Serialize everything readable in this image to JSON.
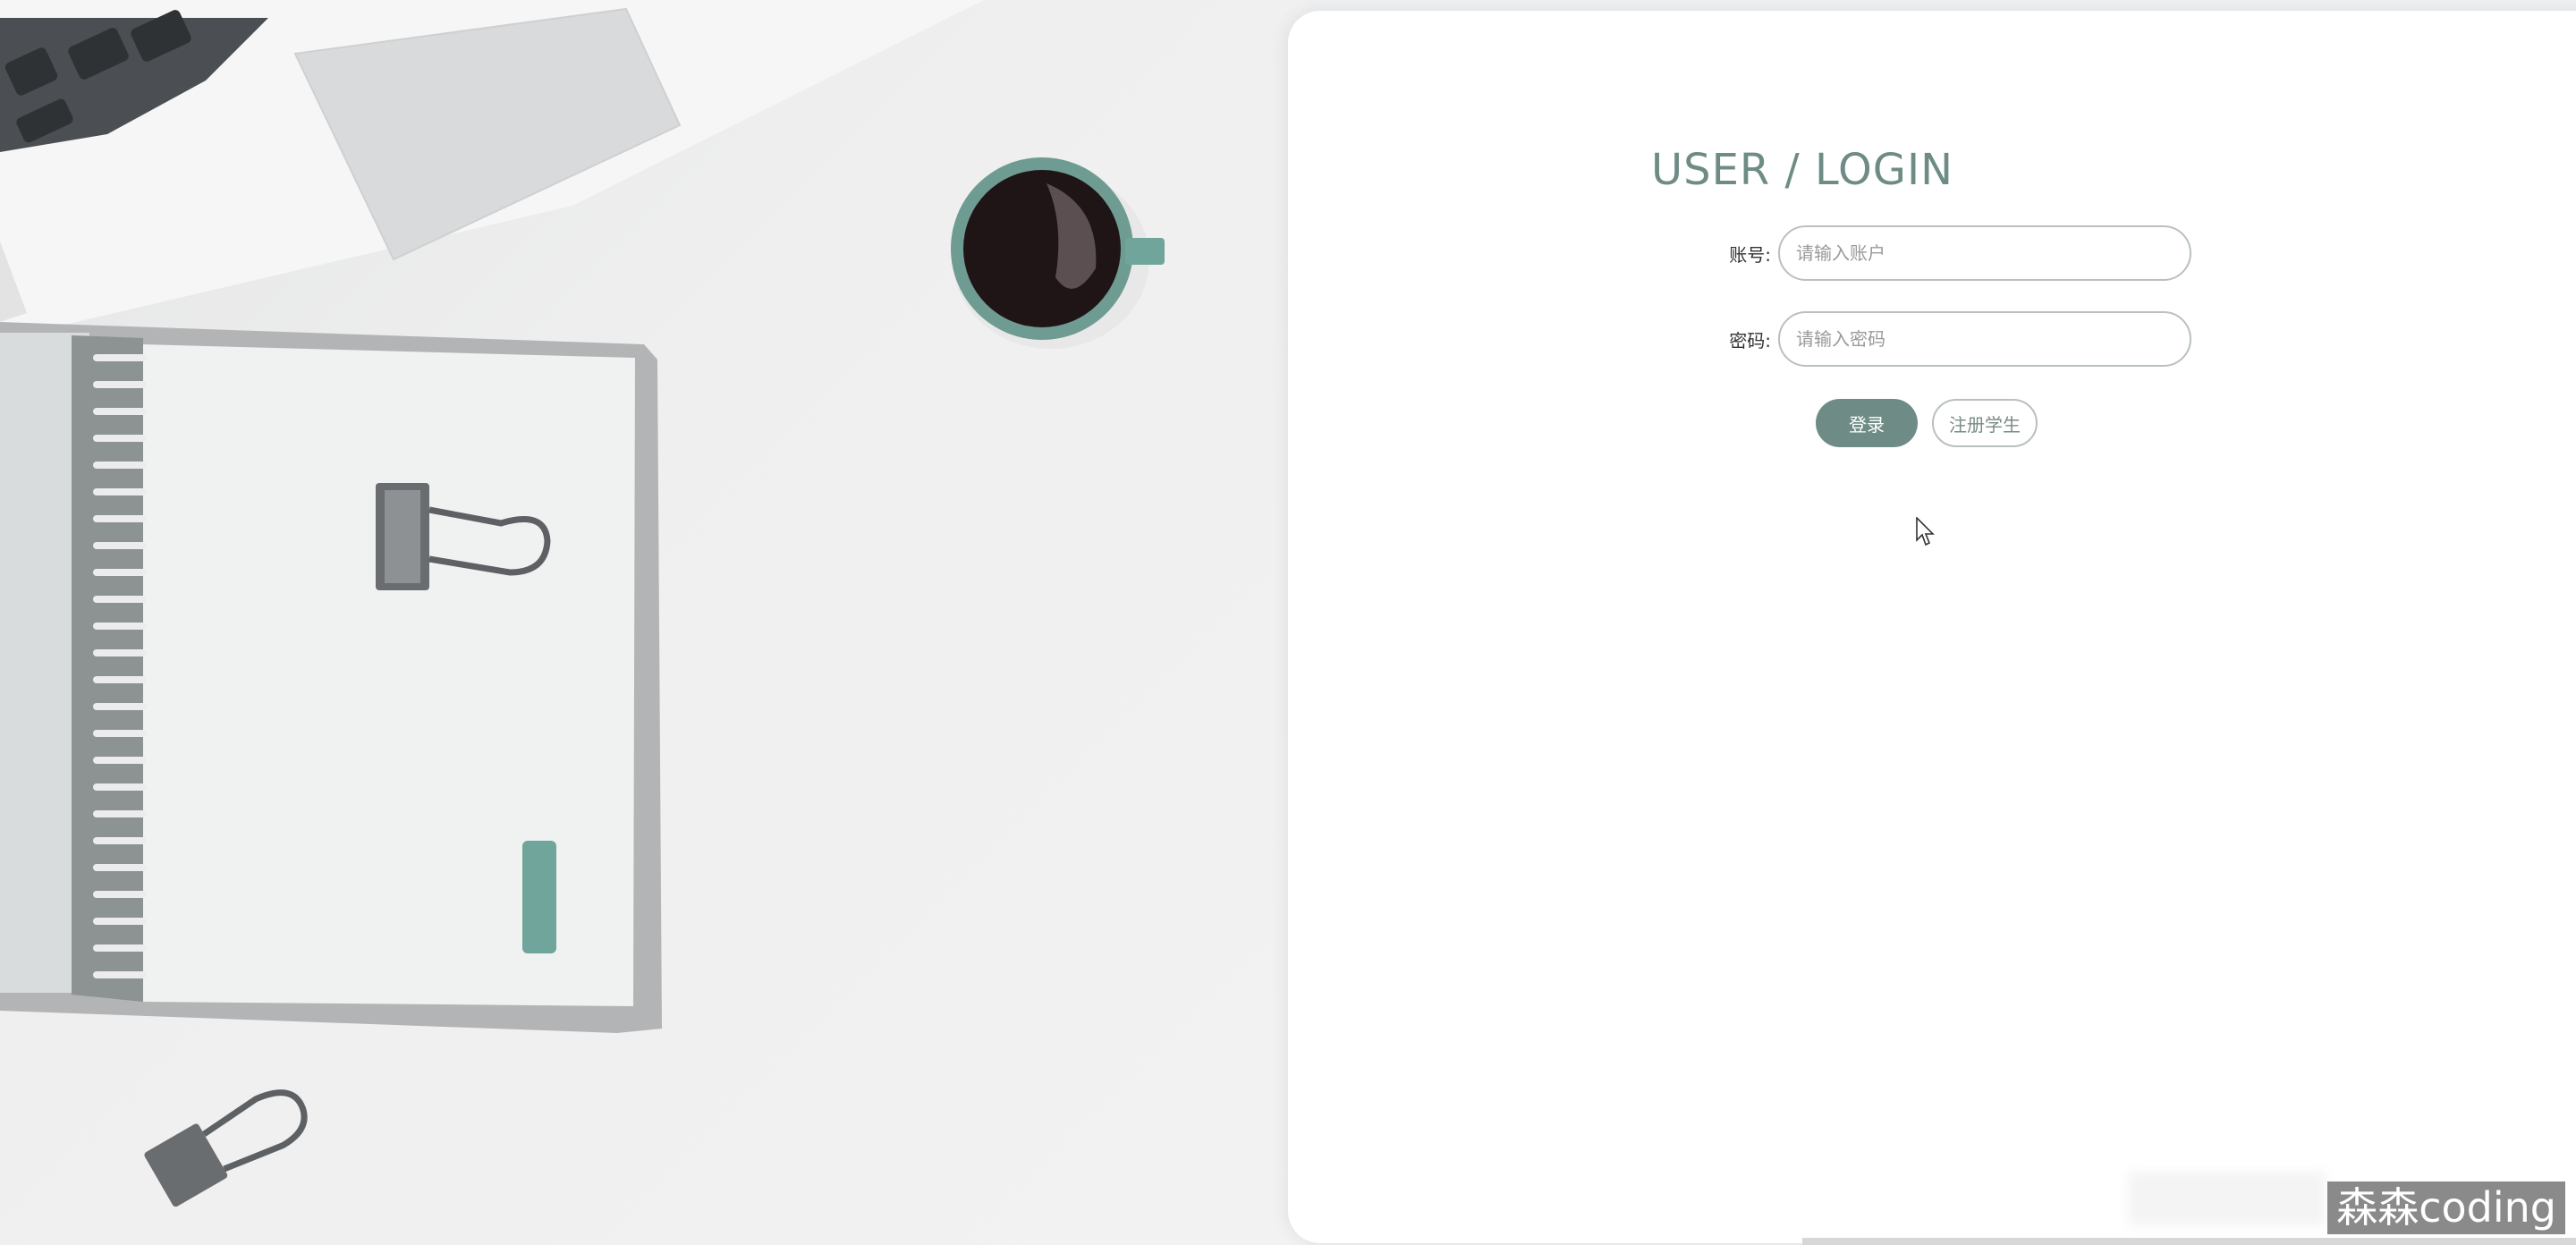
{
  "login": {
    "title": "USER / LOGIN",
    "account_label": "账号:",
    "account_placeholder": "请输入账户",
    "account_value": "",
    "password_label": "密码:",
    "password_placeholder": "请输入密码",
    "password_value": "",
    "login_button": "登录",
    "register_button": "注册学生"
  },
  "watermark": "森森coding",
  "colors": {
    "accent": "#6e8c85",
    "border": "#b9c0be",
    "panel": "#ffffff",
    "desk": "#eeeff0"
  },
  "icons": [
    "cursor-arrow-icon"
  ]
}
